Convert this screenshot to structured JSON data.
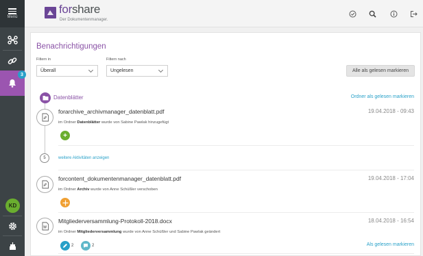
{
  "sidebar": {
    "menu_label": "Menü",
    "notification_badge": "3",
    "avatar_initials": "KD"
  },
  "header": {
    "logo_brand_1": "for",
    "logo_brand_2": "share",
    "logo_tagline": "Der Dokumentenmanager."
  },
  "main": {
    "title": "Benachrichtigungen",
    "filter_in_label": "Filtern in",
    "filter_in_value": "Überall",
    "filter_by_label": "Filtern nach",
    "filter_by_value": "Ungelesen",
    "mark_all_button": "Alle als gelesen markieren",
    "folder": {
      "name": "Datenblätter",
      "mark_read_link": "Ordner als gelesen markieren"
    },
    "more_activities": {
      "count": "5",
      "label": "weitere Aktivitäten anzeigen"
    },
    "notifications": [
      {
        "file_name": "forarchive_archivmanager_datenblatt.pdf",
        "date": "19.04.2018 - 09:43",
        "desc_prefix": "im Ordner ",
        "desc_folder": "Datenblätter",
        "desc_suffix": " wurde von Sabine Pawlak hinzugefügt"
      },
      {
        "file_name": "forcontent_dokumentenmanager_datenblatt.pdf",
        "date": "19.04.2018 - 17:04",
        "desc_prefix": "im Ordner ",
        "desc_folder": "Archiv",
        "desc_suffix": " wurde von Anne Schüßler verschoben"
      },
      {
        "file_name": "Mitgliederversammlung-Protokoll-2018.docx",
        "date": "18.04.2018 - 16:54",
        "desc_prefix": "im Ordner ",
        "desc_folder": "Mitgliederversammlung",
        "desc_suffix": " wurde von Anne Schüßler und Sabine Pawlak geändert",
        "edit_count": "2",
        "comment_count": "2",
        "mark_read_link": "Als gelesen markieren"
      }
    ]
  },
  "colors": {
    "accent_purple": "#8a52a6",
    "link_blue": "#27a0c8",
    "add_green": "#6aae2f",
    "move_orange": "#f0a033"
  }
}
